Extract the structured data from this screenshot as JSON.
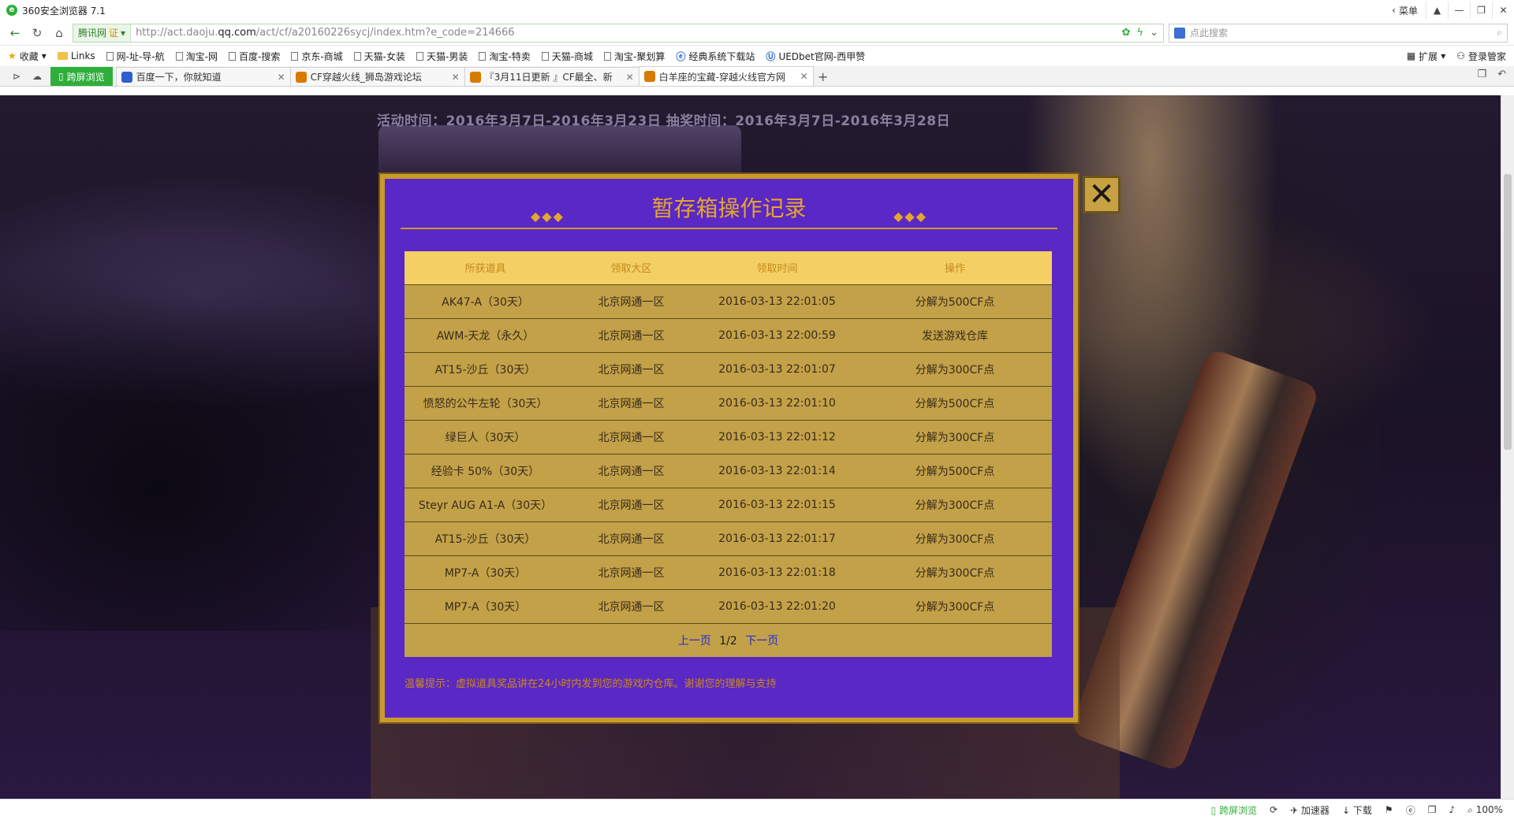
{
  "browser": {
    "title": "360安全浏览器 7.1",
    "menu_label": "菜单",
    "address": {
      "site_badge": "腾讯网",
      "cert_label": "证",
      "url_prefix": "http://act.daoju.",
      "url_domain": "qq.com",
      "url_suffix": "/act/cf/a20160226sycj/index.htm?e_code=214666",
      "search_placeholder": "点此搜索"
    },
    "bookmarks": [
      {
        "label": "收藏",
        "type": "star"
      },
      {
        "label": "Links",
        "type": "folder"
      },
      {
        "label": "网-址-导-航",
        "type": "doc"
      },
      {
        "label": "淘宝-网",
        "type": "doc"
      },
      {
        "label": "百度-搜索",
        "type": "doc"
      },
      {
        "label": "京东-商城",
        "type": "doc"
      },
      {
        "label": "天猫-女装",
        "type": "doc"
      },
      {
        "label": "天猫-男装",
        "type": "doc"
      },
      {
        "label": "淘宝-特卖",
        "type": "doc"
      },
      {
        "label": "天猫-商城",
        "type": "doc"
      },
      {
        "label": "淘宝-聚划算",
        "type": "doc"
      },
      {
        "label": "经典系统下载站",
        "type": "ie"
      },
      {
        "label": "UEDbet官网-西甲赞",
        "type": "ie"
      }
    ],
    "bookmark_right": {
      "extend": "扩展",
      "login": "登录管家"
    },
    "tab_green": "跨屏浏览",
    "tabs": [
      {
        "label": "百度一下，你就知道",
        "active": false
      },
      {
        "label": "CF穿越火线_狮岛游戏论坛",
        "active": false
      },
      {
        "label": "『3月11日更新 』CF最全、新",
        "active": false
      },
      {
        "label": "白羊座的宝藏-穿越火线官方网",
        "active": true
      }
    ],
    "status": {
      "cross_screen": "跨屏浏览",
      "accelerator": "加速器",
      "download": "下载",
      "zoom": "100%"
    }
  },
  "page": {
    "activity_time": "活动时间：2016年3月7日-2016年3月23日 抽奖时间：2016年3月7日-2016年3月28日"
  },
  "modal": {
    "title": "暂存箱操作记录",
    "close_label": "✕",
    "columns": [
      "所获道具",
      "领取大区",
      "领取时间",
      "操作"
    ],
    "rows": [
      [
        "AK47-A（30天）",
        "北京网通一区",
        "2016-03-13 22:01:05",
        "分解为500CF点"
      ],
      [
        "AWM-天龙（永久）",
        "北京网通一区",
        "2016-03-13 22:00:59",
        "发送游戏仓库"
      ],
      [
        "AT15-沙丘（30天）",
        "北京网通一区",
        "2016-03-13 22:01:07",
        "分解为300CF点"
      ],
      [
        "愤怒的公牛左轮（30天）",
        "北京网通一区",
        "2016-03-13 22:01:10",
        "分解为500CF点"
      ],
      [
        "绿巨人（30天）",
        "北京网通一区",
        "2016-03-13 22:01:12",
        "分解为300CF点"
      ],
      [
        "经验卡 50%（30天）",
        "北京网通一区",
        "2016-03-13 22:01:14",
        "分解为500CF点"
      ],
      [
        "Steyr AUG A1-A（30天）",
        "北京网通一区",
        "2016-03-13 22:01:15",
        "分解为300CF点"
      ],
      [
        "AT15-沙丘（30天）",
        "北京网通一区",
        "2016-03-13 22:01:17",
        "分解为300CF点"
      ],
      [
        "MP7-A（30天）",
        "北京网通一区",
        "2016-03-13 22:01:18",
        "分解为300CF点"
      ],
      [
        "MP7-A（30天）",
        "北京网通一区",
        "2016-03-13 22:01:20",
        "分解为300CF点"
      ]
    ],
    "pager": {
      "prev": "上一页",
      "current": "1/2",
      "next": "下一页"
    },
    "tip": "温馨提示：虚拟道具奖品讲在24小时内发到您的游戏内仓库。谢谢您的理解与支持"
  }
}
